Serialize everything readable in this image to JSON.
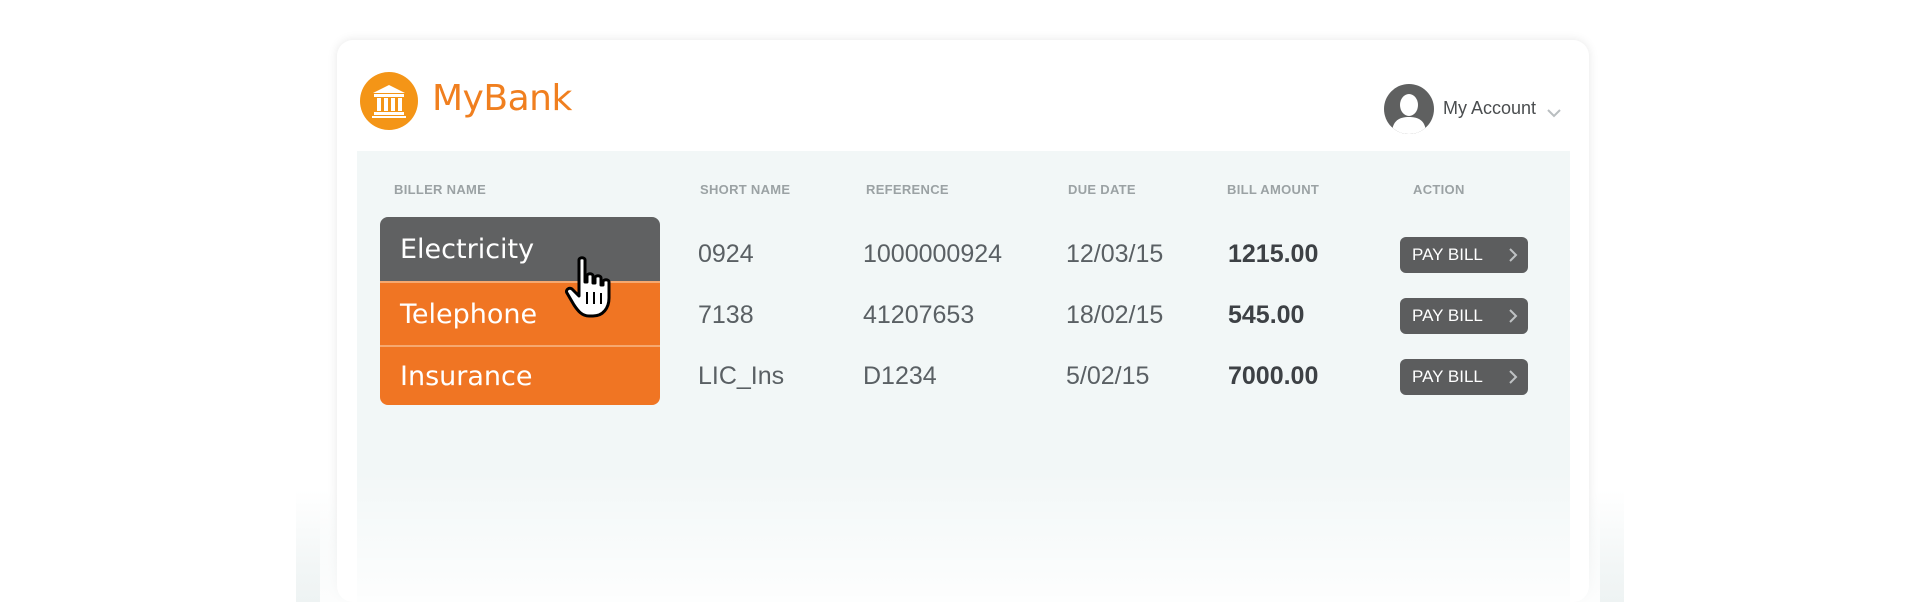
{
  "brand": {
    "name": "MyBank",
    "color": "#f07f1f",
    "icon": "bank-icon"
  },
  "account": {
    "label": "My Account",
    "icon": "user-avatar-icon"
  },
  "table": {
    "headers": {
      "biller_name": "BILLER NAME",
      "short_name": "SHORT NAME",
      "reference": "REFERENCE",
      "due_date": "DUE DATE",
      "bill_amount": "BILL AMOUNT",
      "action": "ACTION"
    },
    "rows": [
      {
        "biller": "Electricity",
        "short_name": "0924",
        "reference": "1000000924",
        "due_date": "12/03/15",
        "amount": "1215.00",
        "action": "PAY BILL",
        "selected": true
      },
      {
        "biller": "Telephone",
        "short_name": "7138",
        "reference": "41207653",
        "due_date": "18/02/15",
        "amount": "545.00",
        "action": "PAY BILL",
        "selected": false
      },
      {
        "biller": "Insurance",
        "short_name": "LIC_Ins",
        "reference": "D1234",
        "due_date": "5/02/15",
        "amount": "7000.00",
        "action": "PAY BILL",
        "selected": false
      }
    ]
  },
  "colors": {
    "accent": "#f07523",
    "selected": "#606162",
    "panel": "#f2f7f7"
  }
}
